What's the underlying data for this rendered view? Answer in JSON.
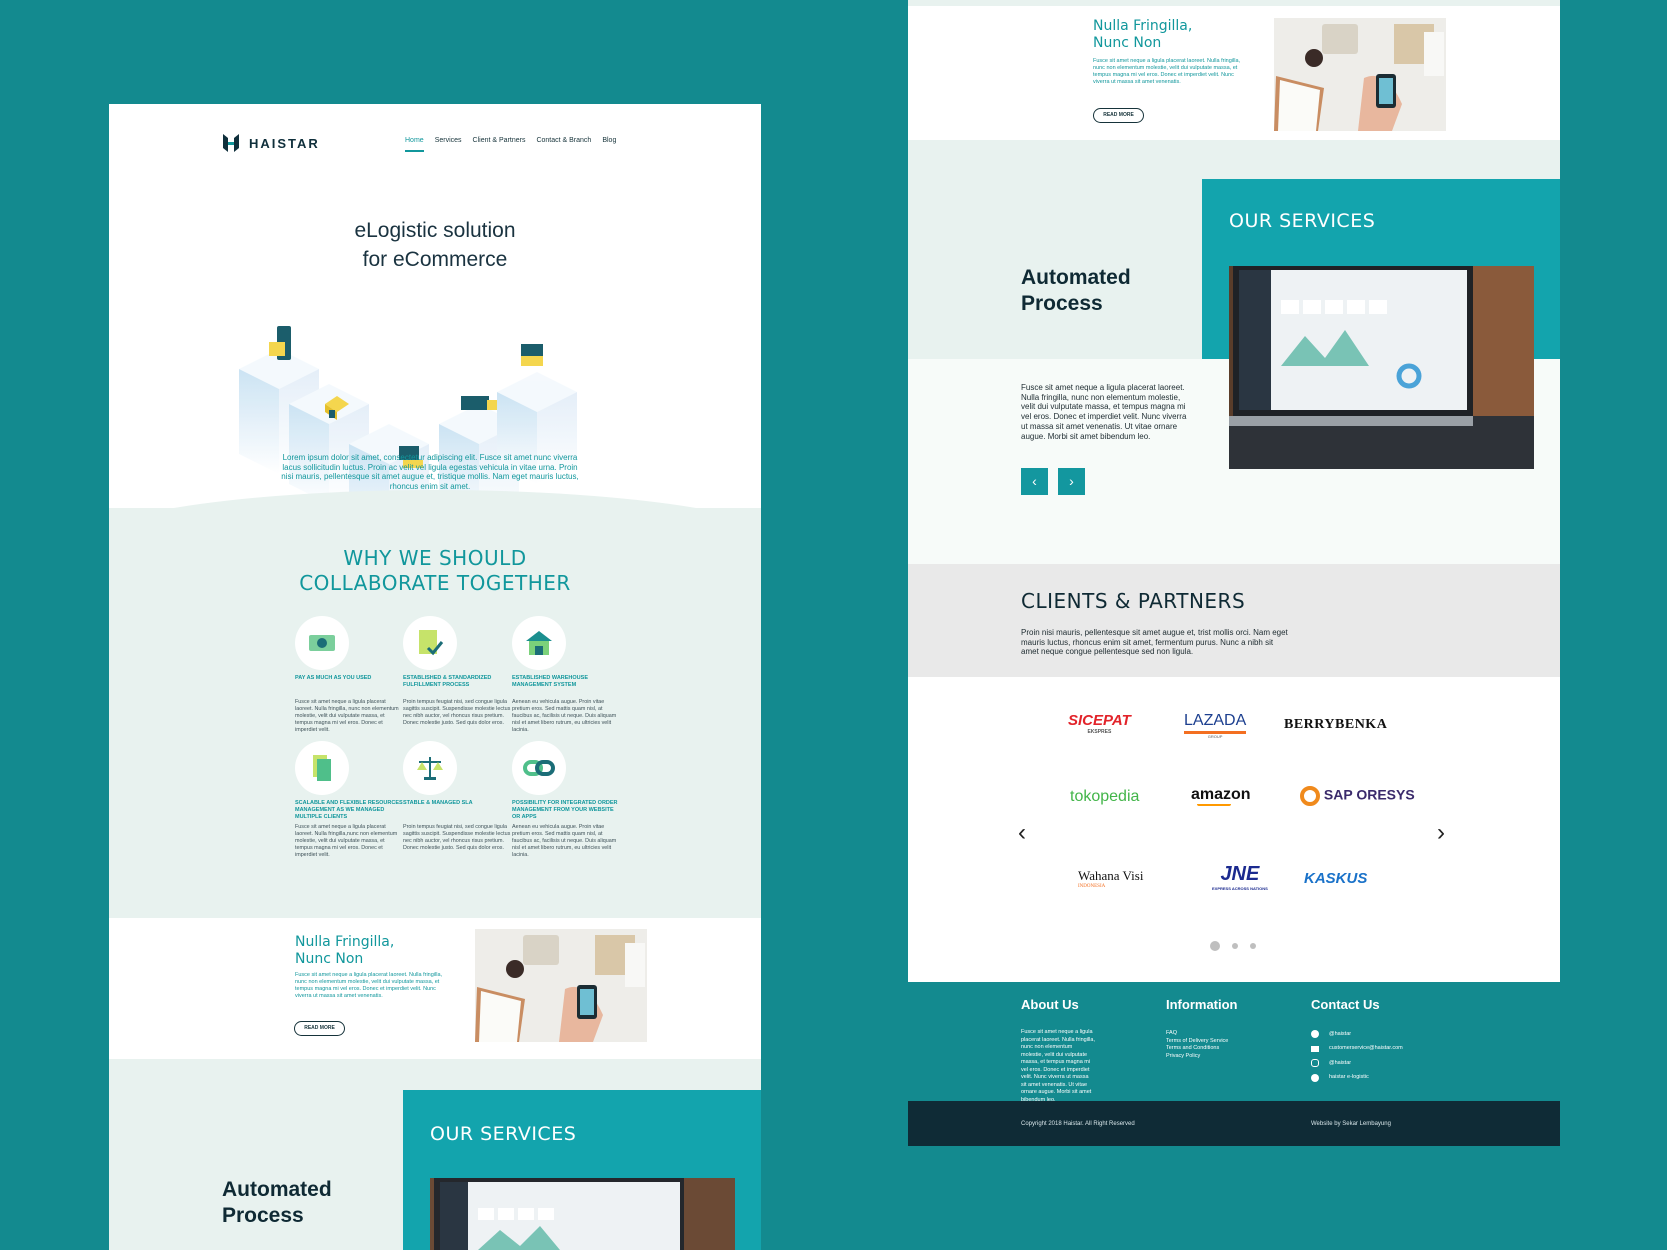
{
  "brand": {
    "logo_text": "HAISTAR"
  },
  "nav": {
    "items": [
      "Home",
      "Services",
      "Client & Partners",
      "Contact & Branch",
      "Blog"
    ]
  },
  "hero": {
    "title_line1": "eLogistic solution",
    "title_line2": "for eCommerce",
    "description": "Lorem ipsum dolor sit amet, consectetur adipiscing elit. Fusce sit amet nunc viverra lacus sollicitudin luctus. Proin ac velit vel ligula egestas vehicula in vitae urna. Proin nisi mauris, pellentesque sit amet augue et, tristique mollis. Nam eget mauris luctus, rhoncus enim sit amet."
  },
  "why": {
    "title_line1": "WHY WE SHOULD",
    "title_line2": "COLLABORATE TOGETHER",
    "features": [
      {
        "icon": "money-icon",
        "title": "PAY AS MUCH AS YOU USED",
        "desc": "Fusce sit amet neque a ligula placerat laoreet. Nulla fringilla, nunc non elementum molestie, velit dui vulputate massa, et tempus magna mi vel eros. Donec et imperdiet velit."
      },
      {
        "icon": "checklist-icon",
        "title": "ESTABLISHED & STANDARDIZED FULFILLMENT PROCESS",
        "desc": "Proin tempus feugiat nisi, sed congue ligula sagittis suscipit. Suspendisse molestie lectus nec nibh auctor, vel rhoncus risus pretium. Donec molestie justo. Sed quis dolor eros."
      },
      {
        "icon": "warehouse-icon",
        "title": "ESTABLISHED WAREHOUSE MANAGEMENT SYSTEM",
        "desc": "Aenean eu vehicula augue. Proin vitae pretium eros. Sed mattis quam nisl, at faucibus ac, facilisis ut neque. Duis aliquam nisl et amet libero rutrum, eu ultricies velit lacinia."
      },
      {
        "icon": "documents-icon",
        "title": "SCALABLE AND FLEXIBLE RESOURCES MANAGEMENT AS WE MANAGED MULTIPLE CLIENTS",
        "desc": "Fusce sit amet neque a ligula placerat laoreet. Nulla fringilla,nunc non elementum molestie, velit dui vulputate massa, et tempus magna mi vel eros. Donec et imperdiet velit."
      },
      {
        "icon": "scale-icon",
        "title": "STABLE & MANAGED SLA",
        "desc": "Proin tempus feugiat nisi, sed congue ligula sagittis suscipit. Suspendisse molestie lectus nec nibh auctor, vel rhoncus risus pretium. Donec molestie justo. Sed quis dolor eros."
      },
      {
        "icon": "link-icon",
        "title": "POSSIBILITY FOR INTEGRATED ORDER MANAGEMENT FROM YOUR WEBSITE OR APPS",
        "desc": "Aenean eu vehicula augue. Proin vitae pretium eros. Sed mattis quam nisl, at faucibus ac, facilisis ut neque. Duis aliquam nisl et amet libero rutrum, eu ultricies velit lacinia."
      }
    ]
  },
  "article": {
    "title_line1": "Nulla Fringilla,",
    "title_line2": "Nunc Non",
    "desc": "Fusce sit amet neque a ligula placerat laoreet. Nulla fringilla, nunc non elementum molestie, velit dui vulputate massa, et tempus magna mi vel eros. Donec et imperdiet velit. Nunc viverra ut massa sit amet venenatis.",
    "button": "READ MORE"
  },
  "services": {
    "heading": "OUR SERVICES",
    "title_line1": "Automated",
    "title_line2": "Process",
    "desc": "Fusce sit amet neque a ligula placerat laoreet. Nulla fringilla, nunc non elementum molestie, velit dui vulputate massa, et tempus magna mi vel eros. Donec et imperdiet velit. Nunc viverra ut massa sit amet venenatis. Ut vitae ornare augue. Morbi sit amet bibendum leo.",
    "prev": "‹",
    "next": "›"
  },
  "clients": {
    "title": "CLIENTS & PARTNERS",
    "desc": "Proin nisi mauris, pellentesque sit amet augue et, trist mollis orci. Nam eget mauris luctus, rhoncus enim sit amet, fermentum purus. Nunc a nibh sit amet neque congue pellentesque sed non ligula.",
    "logos": [
      "SICEPAT",
      "LAZADA",
      "BERRYBENKA",
      "tokopedia",
      "amazon",
      "SAP ORESYS",
      "Wahana Visi",
      "JNE",
      "KASKUS"
    ],
    "logo_sub": {
      "sicepat": "EKSPRES",
      "lazada": "GROUP",
      "wahana": "INDONESIA",
      "jne": "EXPRESS ACROSS NATIONS"
    },
    "prev": "‹",
    "next": "›"
  },
  "footer": {
    "about_title": "About Us",
    "about_text": "Fusce sit amet neque a ligula placerat laoreet. Nulla fringilla, nunc non elementum molestie, velit dui vulputate massa, et tempus magna mi vel eros. Donec et imperdiet velit. Nunc viverra ut massa sit amet venenatis. Ut vitae ornare augue. Morbi sit amet bibendum leo.",
    "info_title": "Information",
    "info_links": [
      "FAQ",
      "Terms of Delivery Service",
      "Terms and Conditions",
      "Privacy Policy"
    ],
    "contact_title": "Contact Us",
    "contacts": [
      "@haistar",
      "customerservice@haistar.com",
      "@haistar",
      "haistar e-logistic"
    ],
    "copyright": "Copyright 2018 Haistar. All Right Reserved",
    "credit": "Website by Sekar Lembayung"
  },
  "colors": {
    "teal": "#13a4ad",
    "bg": "#138a8f",
    "dark": "#0f2b36"
  }
}
